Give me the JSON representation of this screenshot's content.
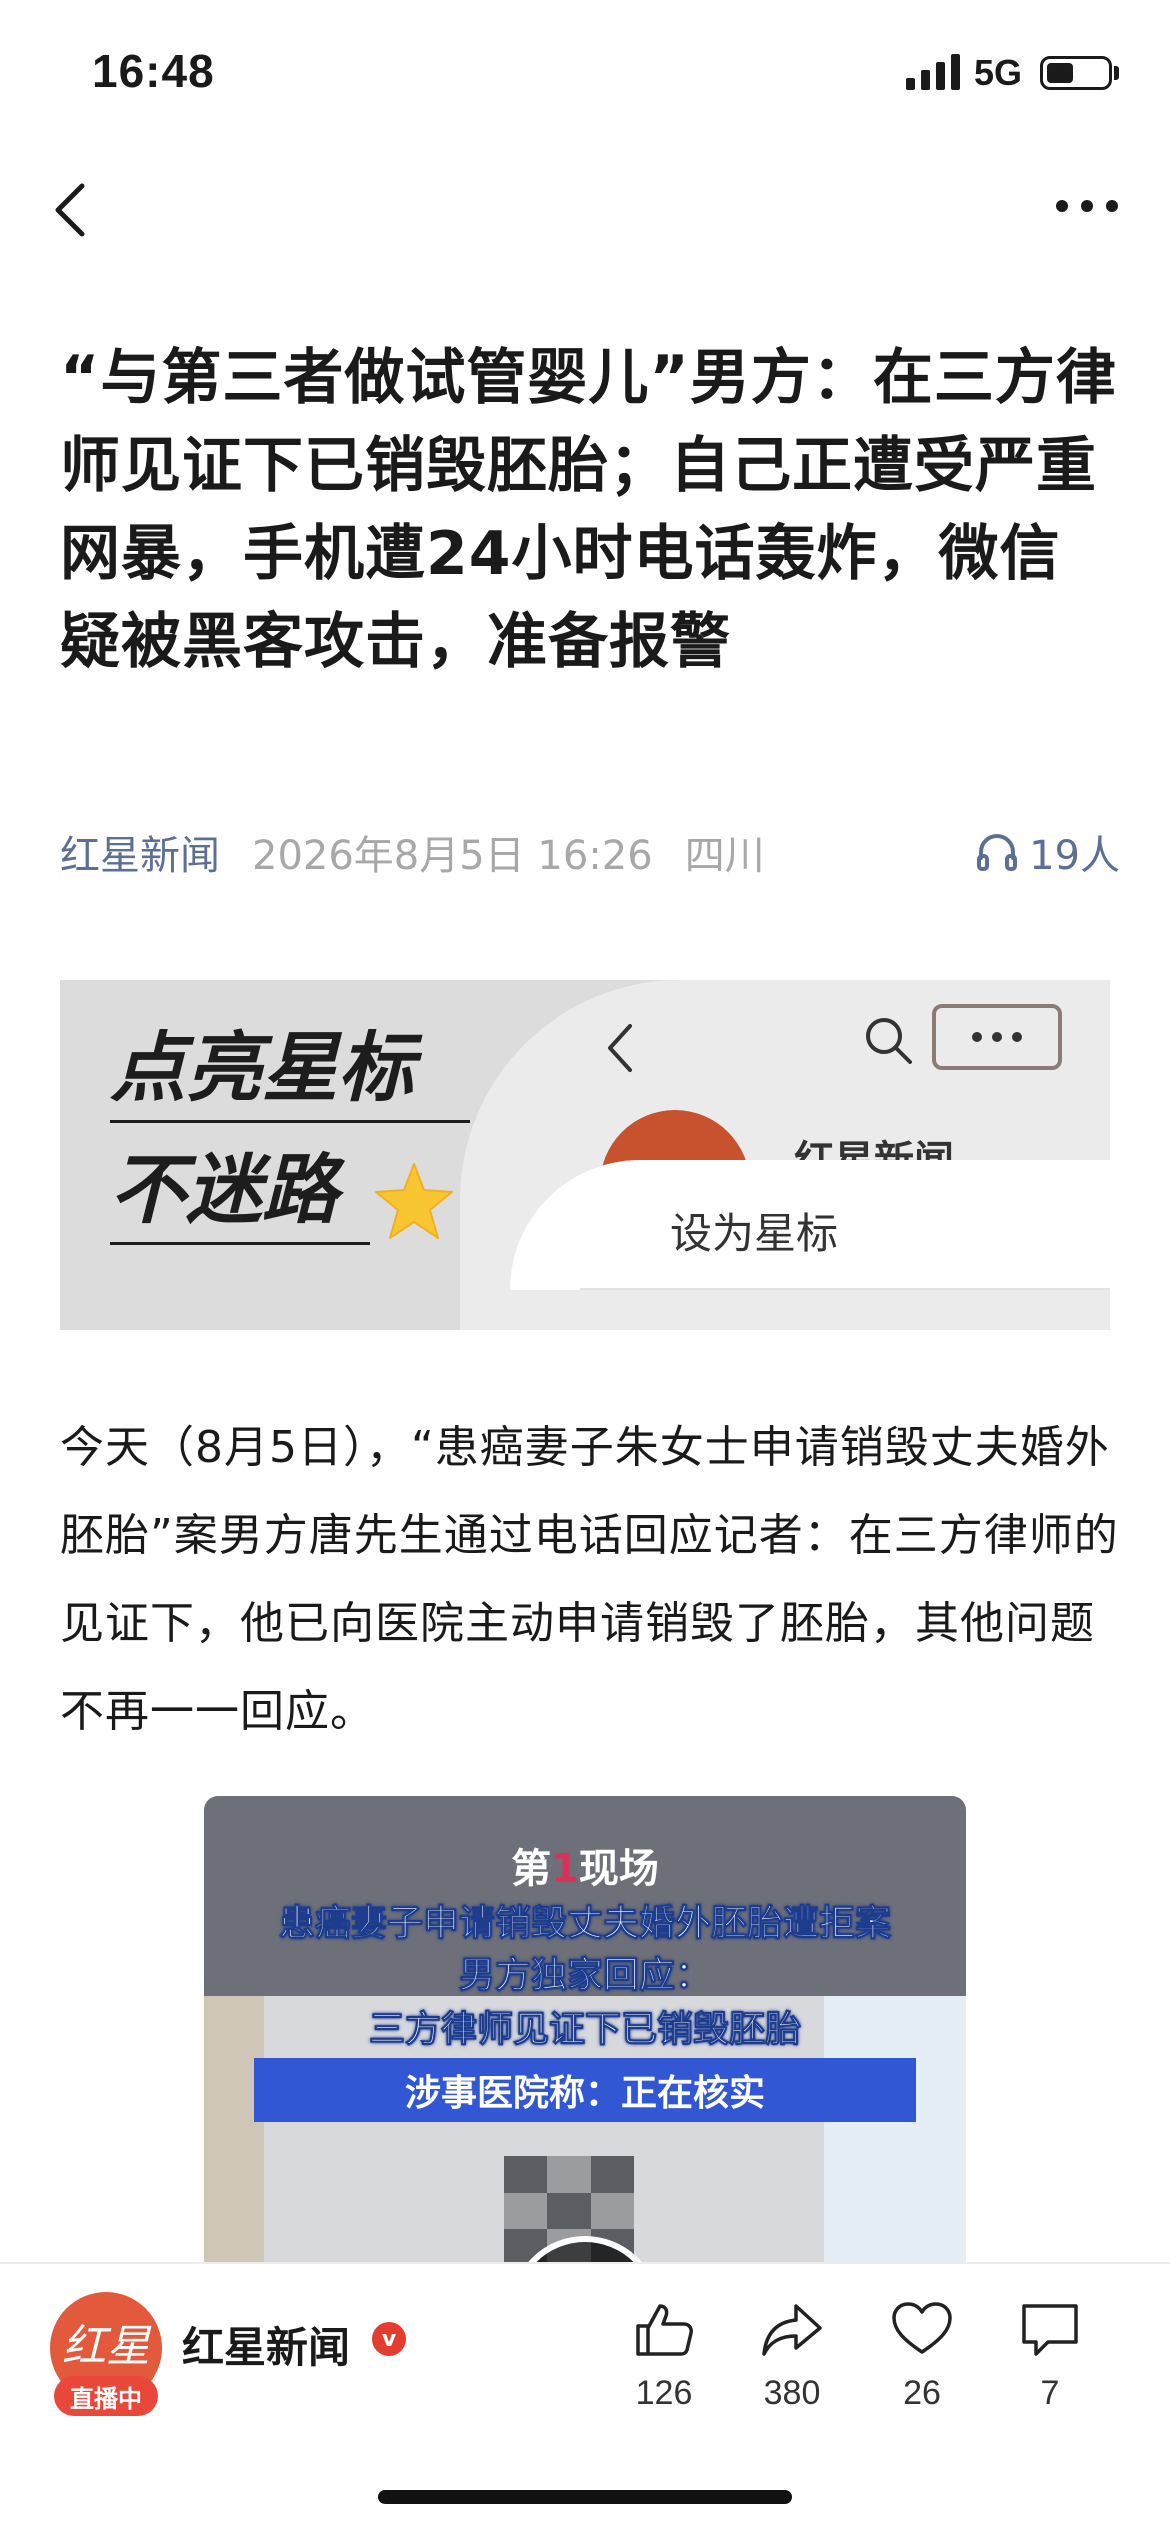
{
  "status_bar": {
    "time": "16:48",
    "network": "5G",
    "battery_percent": 45
  },
  "nav": {
    "back_icon": "chevron-left-icon",
    "more_icon": "ellipsis-icon"
  },
  "article": {
    "title": "“与第三者做试管婴儿”男方：在三方律师见证下已销毁胚胎；自己正遭受严重网暴，手机遭24小时电话轰炸，微信疑被黑客攻击，准备报警",
    "source": "红星新闻",
    "date": "2026年8月5日 16:26",
    "region": "四川",
    "listeners": "19人",
    "paragraph": "今天（8月5日），“患癌妻子朱女士申请销毁丈夫婚外胚胎”案男方唐先生通过电话回应记者：在三方律师的见证下，他已向医院主动申请销毁了胚胎，其他问题不再一一回应。"
  },
  "banner": {
    "slogan_line1": "点亮星标",
    "slogan_line2": "不迷路",
    "brand_name": "红星新闻",
    "card_label": "设为星标",
    "star_icon": "star-icon"
  },
  "video": {
    "brand_prefix": "第",
    "brand_number": "1",
    "brand_suffix": "现场",
    "title_line1": "患癌妻子申请销毁丈夫婚外胚胎遭拒案",
    "title_line2": "男方独家回应：",
    "title_line3": "三方律师见证下已销毁胚胎",
    "bar_text": "涉事医院称：正在核实"
  },
  "bottom_bar": {
    "avatar_logo": "红星",
    "live_badge": "直播中",
    "source_name": "红星新闻",
    "verified_mark": "v",
    "likes": "126",
    "shares": "380",
    "favorites": "26",
    "comments": "7"
  },
  "colors": {
    "source_blue": "#5c6f94",
    "brand_red": "#e2593b",
    "video_bar_blue": "#3257d4"
  }
}
